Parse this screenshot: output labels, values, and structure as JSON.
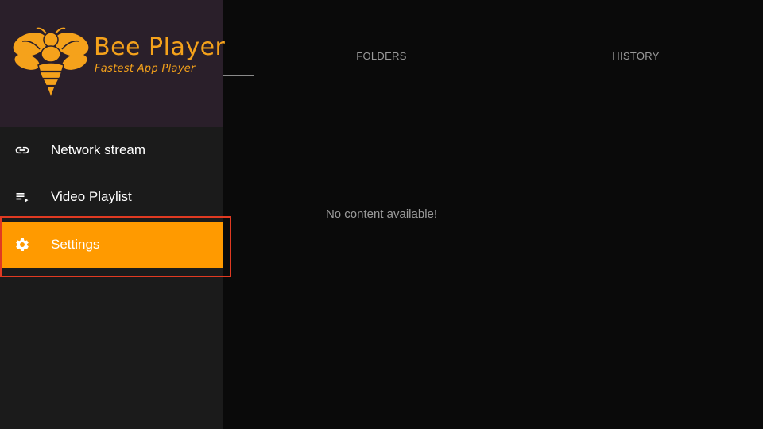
{
  "app": {
    "title": "Bee Player",
    "tagline": "Fastest App Player",
    "brand_color": "#f5a21b"
  },
  "tabs": [
    {
      "label": "",
      "selected": true
    },
    {
      "label": "FOLDERS",
      "selected": false
    },
    {
      "label": "HISTORY",
      "selected": false
    }
  ],
  "main": {
    "empty_message": "No content available!"
  },
  "drawer": {
    "items": [
      {
        "label": "Network stream",
        "icon": "link-icon"
      },
      {
        "label": "Video Playlist",
        "icon": "playlist-play-icon"
      },
      {
        "label": "Settings",
        "icon": "gear-icon",
        "highlighted": true,
        "highlight_color": "#ff9a00"
      }
    ],
    "focus_color": "#e03a22"
  }
}
